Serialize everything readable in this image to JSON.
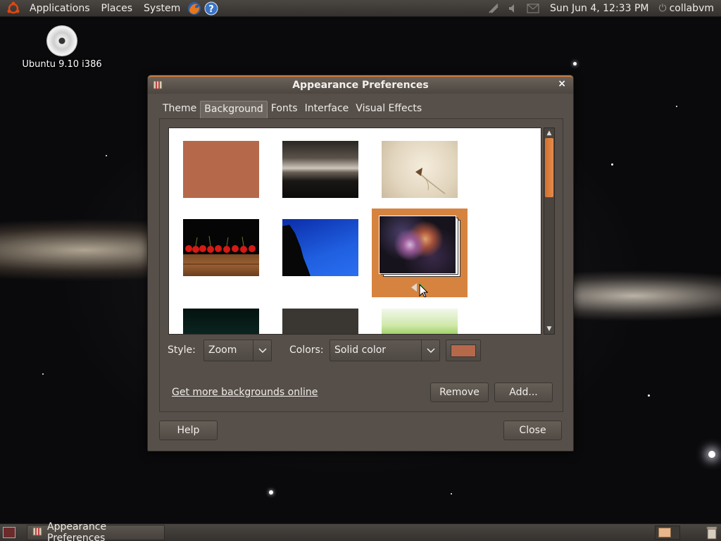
{
  "top_panel": {
    "menus": [
      "Applications",
      "Places",
      "System"
    ],
    "clock": "Sun Jun  4, 12:33 PM",
    "user": "collabvm"
  },
  "desktop": {
    "cd_label": "Ubuntu 9.10 i386"
  },
  "window": {
    "title": "Appearance Preferences",
    "close_glyph": "×",
    "tabs": [
      "Theme",
      "Background",
      "Fonts",
      "Interface",
      "Visual Effects"
    ],
    "active_tab": "Background",
    "style_label": "Style:",
    "style_value": "Zoom",
    "colors_label": "Colors:",
    "colors_value": "Solid color",
    "selected_color": "#b5694a",
    "more_link": "Get more backgrounds online",
    "remove_button": "Remove",
    "add_button": "Add...",
    "help_button": "Help",
    "close_button": "Close"
  },
  "bottom_panel": {
    "task_label": "Appearance Preferences"
  },
  "colors": {
    "accent": "#d0712f",
    "selection": "#d6833f"
  }
}
